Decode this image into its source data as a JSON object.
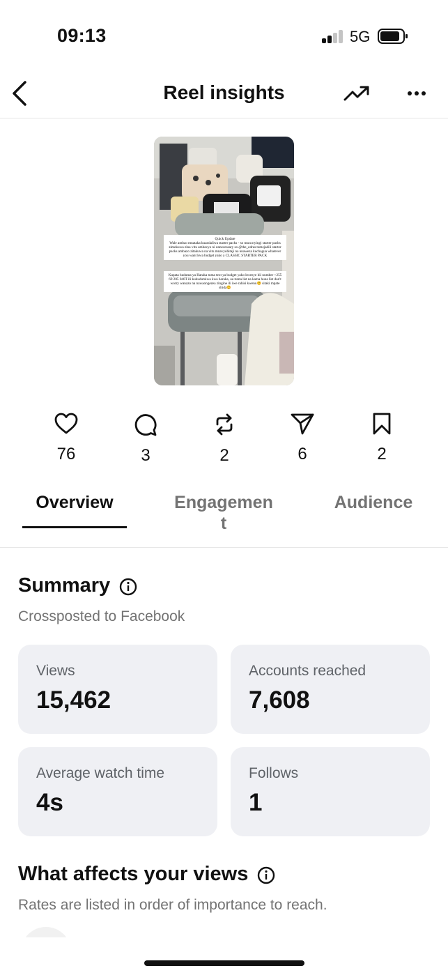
{
  "status_bar": {
    "time": "09:13",
    "network": "5G"
  },
  "header": {
    "title": "Reel insights"
  },
  "thumbnail": {
    "caption_title": "Quick Update",
    "caption_body": "Wale ambao mnataka kuandaliwa starter packs - so mara nyingi starter packs zimekuwa zina vitu ambavyo ni unnecessary so @the_edras tumejadili starter packs ambazo zitakuwa na vitu mnavyohitaji na unaweza kuchagua whatever you want kwa budget yako a CLASSIC STARTER PACK",
    "caption_body2": "Kupata huduma ya Haraka tuma text ya budget yako kwenye hii number +255 69 205 040T ili kuhudumiwa kwa haraka, au tuma list na kama huna list don't worry wanazo na nawaongezea zingine ili iwe rahisi kwenu😊 sitaki mpate shida😊"
  },
  "metrics": [
    {
      "icon": "heart-icon",
      "value": "76"
    },
    {
      "icon": "comment-icon",
      "value": "3"
    },
    {
      "icon": "repost-icon",
      "value": "2"
    },
    {
      "icon": "share-icon",
      "value": "6"
    },
    {
      "icon": "bookmark-icon",
      "value": "2"
    }
  ],
  "tabs": [
    {
      "label": "Overview",
      "active": true
    },
    {
      "label_line1": "Engagemen",
      "label_line2": "t",
      "active": false
    },
    {
      "label": "Audience",
      "active": false
    }
  ],
  "summary": {
    "title": "Summary",
    "subtitle": "Crossposted to Facebook",
    "cards": [
      {
        "label": "Views",
        "value": "15,462"
      },
      {
        "label": "Accounts reached",
        "value": "7,608"
      },
      {
        "label": "Average watch time",
        "value": "4s"
      },
      {
        "label": "Follows",
        "value": "1"
      }
    ]
  },
  "views_section": {
    "title": "What affects your views",
    "subtitle": "Rates are listed in order of importance to reach."
  },
  "colors": {
    "card_bg": "#eff0f4",
    "muted_text": "#737373",
    "text": "#111111"
  }
}
